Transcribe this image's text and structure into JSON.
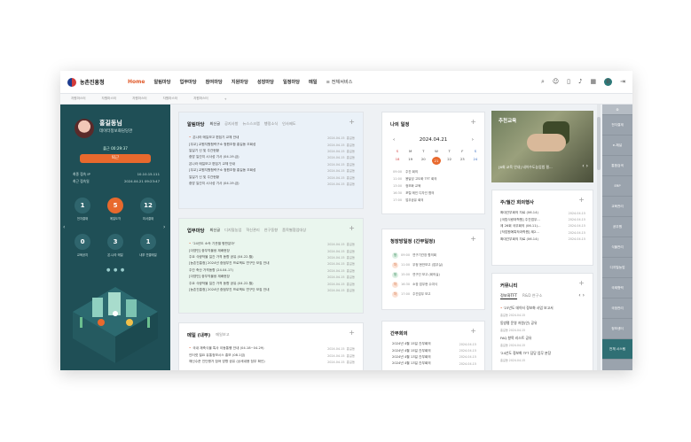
{
  "app": {
    "logo": "농촌진흥청"
  },
  "nav": {
    "items": [
      "Home",
      "알림마당",
      "업무마당",
      "참여마당",
      "지원마당",
      "성장마당",
      "일정마당",
      "메일"
    ],
    "all_services": "≡ 전체서비스"
  },
  "topbar": {
    "avatar_letter": "B"
  },
  "breadcrumbs": [
    "자원마스터",
    "자원마스터",
    "자원마스터",
    "자원마스터",
    "자원마스터",
    "+"
  ],
  "profile": {
    "name": "홍길동님",
    "dept": "데이터정보화담당관",
    "checkin": "출근 00:29:37",
    "leave_button": "퇴근",
    "rows": [
      {
        "k": "최종 접속 IP",
        "v": "10.10.15.111"
      },
      {
        "k": "최근 접속일",
        "v": "2024.04.21 09:23:47"
      }
    ],
    "stats": [
      {
        "value": "1",
        "label": "전자결재"
      },
      {
        "value": "5",
        "label": "메일도착"
      },
      {
        "value": "12",
        "label": "미서결재"
      },
      {
        "value": "0",
        "label": "교육공지"
      },
      {
        "value": "3",
        "label": "온-나라 메일"
      },
      {
        "value": "1",
        "label": "내부 연결메일"
      }
    ],
    "arrow_left": "‹",
    "arrow_right": "›",
    "dots": "● ● ●"
  },
  "notice": {
    "title": "알림마당",
    "tabs": [
      "최신글",
      "공지사항",
      "뉴스스크랩",
      "행정소식",
      "인사제도"
    ],
    "items": [
      {
        "t": "온나라 메일보고 편집기 교체 안내",
        "d": "2024.04.15",
        "w": "홍길동"
      },
      {
        "t": "[무교] 교원지원협력구소 청원조합 홍길동 조회성",
        "d": "2024.04.15",
        "w": "홍길동"
      },
      {
        "t": "일일기 신 및 주간현황",
        "d": "2024.04.15",
        "w": "홍길동"
      },
      {
        "t": "중앙 일간지 시사성 기사 (04.19.금)",
        "d": "2024.04.15",
        "w": "홍길동"
      },
      {
        "t": "온나라 메일보고 편집기 교체 안내",
        "d": "2024.04.15",
        "w": "홍길동"
      },
      {
        "t": "[무교] 교원지원협력구소 청원조합 홍길동 조회성",
        "d": "2024.04.15",
        "w": "홍길동"
      },
      {
        "t": "일일기 신 및 주간현황",
        "d": "2024.04.15",
        "w": "홍길동"
      },
      {
        "t": "중앙 일간지 시사성 기사 (04.19.금)",
        "d": "2024.04.15",
        "w": "홍길동"
      }
    ]
  },
  "work": {
    "title": "업무마당",
    "tabs": [
      "최신글",
      "디지털농업",
      "혁신관리",
      "연구동향",
      "품목별협업대상"
    ],
    "items": [
      {
        "t": "'24년도 소속 기관별 평판분야'",
        "d": "2024.04.15",
        "w": "홍길동"
      },
      {
        "t": "[이영민] 중부직물쌍 재배현장",
        "d": "2024.04.15",
        "w": "홍길동"
      },
      {
        "t": "주요 식량작물 일간 가격 동향 공유 (04.22.월)",
        "d": "2024.04.15",
        "w": "홍길동"
      },
      {
        "t": "[농촌진흥청] 2024년 중점부진 프로젝트 연구단 모집 안내",
        "d": "2024.04.15",
        "w": "홍길동"
      },
      {
        "t": "주간 축산 가격동향 (24.04.17)",
        "d": "2024.04.15",
        "w": "홍길동"
      },
      {
        "t": "[이영민] 중부직물쌍 재배현장",
        "d": "2024.04.15",
        "w": "홍길동"
      },
      {
        "t": "주요 식량작물 일간 가격 동향 공유 (04.22.월)",
        "d": "2024.04.15",
        "w": "홍길동"
      },
      {
        "t": "[농촌진흥청] 2024년 중점부진 프로젝트 연구단 모집 안내",
        "d": "2024.04.15",
        "w": "홍길동"
      }
    ]
  },
  "mail": {
    "title": "메일 (내부)",
    "tabs": [
      "메일보고"
    ],
    "items": [
      {
        "t": "국내 재축식물 특사 이동통행 안내 (04.18~04.29)",
        "d": "2024.04.15",
        "w": "홍길동"
      },
      {
        "t": "인터넷 필요 유통정보시스 홍보 (08.1검)",
        "d": "2024.04.15",
        "w": "홍길동"
      },
      {
        "t": "해신수준 진단평가 참여 방향 공유 (상세내용 첨부 확인)",
        "d": "2024.04.15",
        "w": "홍길동"
      }
    ]
  },
  "calendar": {
    "title": "나의 일정",
    "month": "2024.04.21",
    "prev": "‹",
    "next": "›",
    "weekdays": [
      "S",
      "M",
      "T",
      "W",
      "T",
      "F",
      "S"
    ],
    "days": [
      "18",
      "19",
      "20",
      "21",
      "22",
      "23",
      "24"
    ],
    "today": "21",
    "schedule": [
      {
        "time": "09:00",
        "text": "주간 회의"
      },
      {
        "time": "11:00",
        "text": "용달성 고도화 TFT 회의"
      },
      {
        "time": "13:00",
        "text": "정보화 교육"
      },
      {
        "time": "16:30",
        "text": "포털 메인 디자인 협의"
      },
      {
        "time": "17:00",
        "text": "업무공유 회의"
      }
    ]
  },
  "director": {
    "title": "청장방일정 (간부일정)",
    "items": [
      {
        "tag": "청",
        "type": "g",
        "time": "09:00",
        "text": "연구기관장 협의회"
      },
      {
        "tag": "차",
        "type": "o",
        "time": "11:00",
        "text": "우정 현안보고 (업무실)"
      },
      {
        "tag": "청",
        "type": "g",
        "time": "15:00",
        "text": "연구인 보고 (회의실)"
      },
      {
        "tag": "차",
        "type": "o",
        "time": "16:30",
        "text": "소장 업무현 수여식"
      },
      {
        "tag": "차",
        "type": "o",
        "time": "17:00",
        "text": "주간업무 보고"
      }
    ]
  },
  "exec_meeting": {
    "title": "간부회의",
    "items": [
      {
        "t": "2024년 4월 15일 간부회의",
        "d": "2024.04.15"
      },
      {
        "t": "2024년 4월 15일 간부회의",
        "d": "2024.04.15"
      },
      {
        "t": "2024년 4월 13일 간부회의",
        "d": "2024.04.15"
      },
      {
        "t": "2024년 4월 13일 간부회의",
        "d": "2024.04.15"
      }
    ]
  },
  "photo_news": {
    "title": "추천교육",
    "caption": "[6회 교육 안내] 네이수도농업법 필...",
    "nav": "‹ ›"
  },
  "events": {
    "title": "주/월간 회의행사",
    "items": [
      {
        "t": "확대간부회의 자료 (06.14)",
        "d": "2024.04.15"
      },
      {
        "t": "[국립식량과학원] 주간업무...",
        "d": "2024.04.15"
      },
      {
        "t": "제 26회 국무회의 (06.11)...",
        "d": "2024.04.15"
      },
      {
        "t": "[작업원예특작과학원] 제2...",
        "d": "2024.04.15"
      },
      {
        "t": "확대간부회의 자료 (06.14)",
        "d": "2024.04.15"
      }
    ]
  },
  "community": {
    "title": "커뮤니티",
    "tabs": [
      "정보화TFT",
      "R&D 연구소"
    ],
    "arrows": "‹ ›",
    "items": [
      {
        "t": "'23년도 데이터 정보화 사업 보고서",
        "m": "홍길동  2024.04.15"
      },
      {
        "t": "동방평 운영 저원(안) 공유",
        "m": "홍길동  2024.04.15"
      },
      {
        "t": "FAQ 항목 리스트 공유",
        "m": "홍길동  2024.04.15"
      },
      {
        "t": "'24년도 정보화 TFT 담당 업무 분장",
        "m": "홍길동  2024.04.15"
      }
    ]
  },
  "rail": {
    "items": [
      "⚙",
      "전자결재",
      "e-채널",
      "통합검색",
      "ERP",
      "교육관리",
      "공무원",
      "식물관리",
      "디지털농업",
      "국제협력",
      "국정관리",
      "정보센터",
      "전체 시스템"
    ]
  },
  "colors": {
    "accent": "#e8692d",
    "panel": "#1f4f56",
    "rail": "#9aa3ad"
  }
}
